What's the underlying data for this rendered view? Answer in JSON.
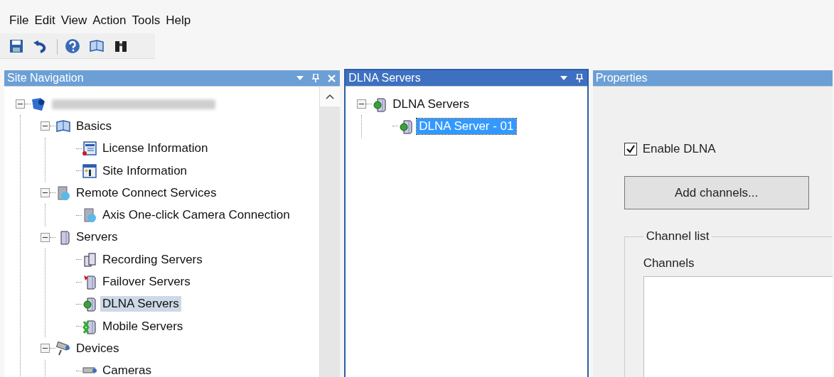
{
  "menu": [
    "File",
    "Edit",
    "View",
    "Action",
    "Tools",
    "Help"
  ],
  "toolbar": [
    {
      "kind": "save"
    },
    {
      "kind": "undo"
    },
    {
      "kind": "separator"
    },
    {
      "kind": "help"
    },
    {
      "kind": "book"
    },
    {
      "kind": "find"
    }
  ],
  "site_navigation": {
    "title": "Site Navigation",
    "active": false,
    "menu_button": true,
    "pinnable": true,
    "closable": true,
    "tree": [
      {
        "kind": "site",
        "expanded": true,
        "selected": false,
        "children": [
          {
            "label": "Basics",
            "kind": "book",
            "expanded": true,
            "selected": false,
            "children": [
              {
                "label": "License Information",
                "kind": "license",
                "selected": false
              },
              {
                "label": "Site Information",
                "kind": "info",
                "selected": false
              }
            ]
          },
          {
            "label": "Remote Connect Services",
            "kind": "remote",
            "expanded": true,
            "selected": false,
            "children": [
              {
                "label": "Axis One-click Camera Connection",
                "kind": "remote",
                "selected": false
              }
            ]
          },
          {
            "label": "Servers",
            "kind": "servers",
            "expanded": true,
            "selected": false,
            "children": [
              {
                "label": "Recording Servers",
                "kind": "recording",
                "selected": false
              },
              {
                "label": "Failover Servers",
                "kind": "failover",
                "selected": false
              },
              {
                "label": "DLNA Servers",
                "kind": "dlna",
                "selected": true
              },
              {
                "label": "Mobile Servers",
                "kind": "mobile",
                "selected": false
              }
            ]
          },
          {
            "label": "Devices",
            "kind": "devices",
            "expanded": true,
            "selected": false,
            "children": [
              {
                "label": "Cameras",
                "kind": "camera",
                "selected": false
              }
            ]
          }
        ]
      }
    ]
  },
  "dlna_servers": {
    "title": "DLNA Servers",
    "active": true,
    "menu_button": true,
    "pinnable": true,
    "closable": false,
    "tree": [
      {
        "label": "DLNA Servers",
        "kind": "dlna",
        "expanded": true,
        "selected": false,
        "children": [
          {
            "label": "DLNA Server - 01",
            "kind": "dlna",
            "selected": true
          }
        ]
      }
    ]
  },
  "properties": {
    "title": "Properties",
    "active": false,
    "enable_dlna": {
      "label": "Enable DLNA",
      "checked": true
    },
    "add_button": "Add channels...",
    "channel_list": {
      "title": "Channel list",
      "channels_label": "Channels"
    }
  }
}
